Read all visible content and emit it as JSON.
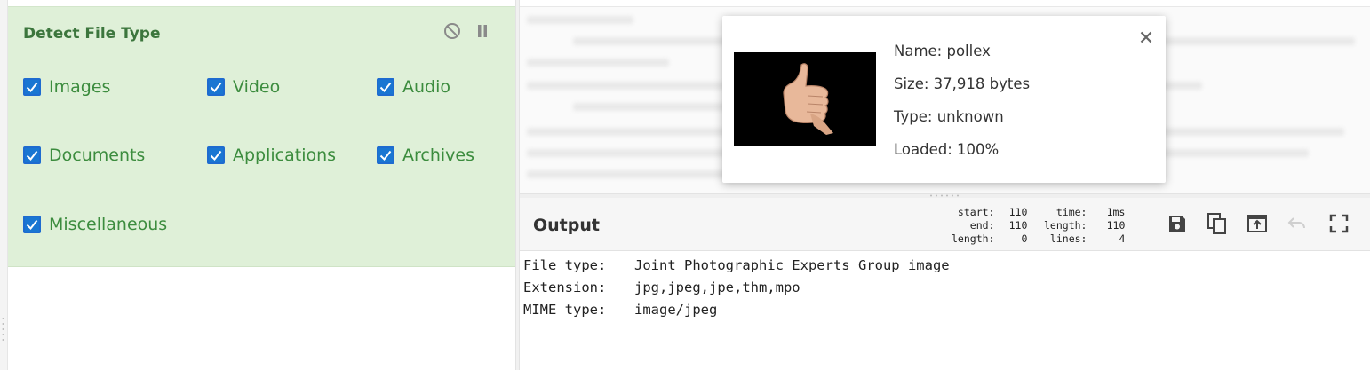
{
  "operation": {
    "title": "Detect File Type",
    "disable_icon": "disable-icon",
    "pause_icon": "pause-icon",
    "checkboxes": [
      {
        "label": "Images",
        "checked": true
      },
      {
        "label": "Video",
        "checked": true
      },
      {
        "label": "Audio",
        "checked": true
      },
      {
        "label": "Documents",
        "checked": true
      },
      {
        "label": "Applications",
        "checked": true
      },
      {
        "label": "Archives",
        "checked": true
      },
      {
        "label": "Miscellaneous",
        "checked": true
      }
    ]
  },
  "popup": {
    "name": "Name: pollex",
    "size": "Size: 37,918 bytes",
    "type": "Type: unknown",
    "loaded": "Loaded: 100%",
    "close_icon": "close-icon",
    "thumbnail": "thumbs-up-hand-image"
  },
  "output": {
    "title": "Output",
    "stats": {
      "start_label": "start:",
      "start_value": "110",
      "end_label": "end:",
      "end_value": "110",
      "length_label": "length:",
      "length_value": "0",
      "time_label": "time:",
      "time_value": "1ms",
      "length2_label": "length:",
      "length2_value": "110",
      "lines_label": "lines:",
      "lines_value": "4"
    },
    "toolbar": [
      "save-icon",
      "copy-icon",
      "replace-input-icon",
      "undo-icon",
      "maximise-icon"
    ],
    "lines": [
      {
        "key": "File type:",
        "value": "Joint Photographic Experts Group image"
      },
      {
        "key": "Extension:",
        "value": "jpg,jpeg,jpe,thm,mpo"
      },
      {
        "key": "MIME type:",
        "value": "image/jpeg"
      }
    ]
  },
  "colors": {
    "operation_bg": "#dff0d8",
    "operation_text": "#3c763d",
    "checkbox": "#1976d2"
  }
}
